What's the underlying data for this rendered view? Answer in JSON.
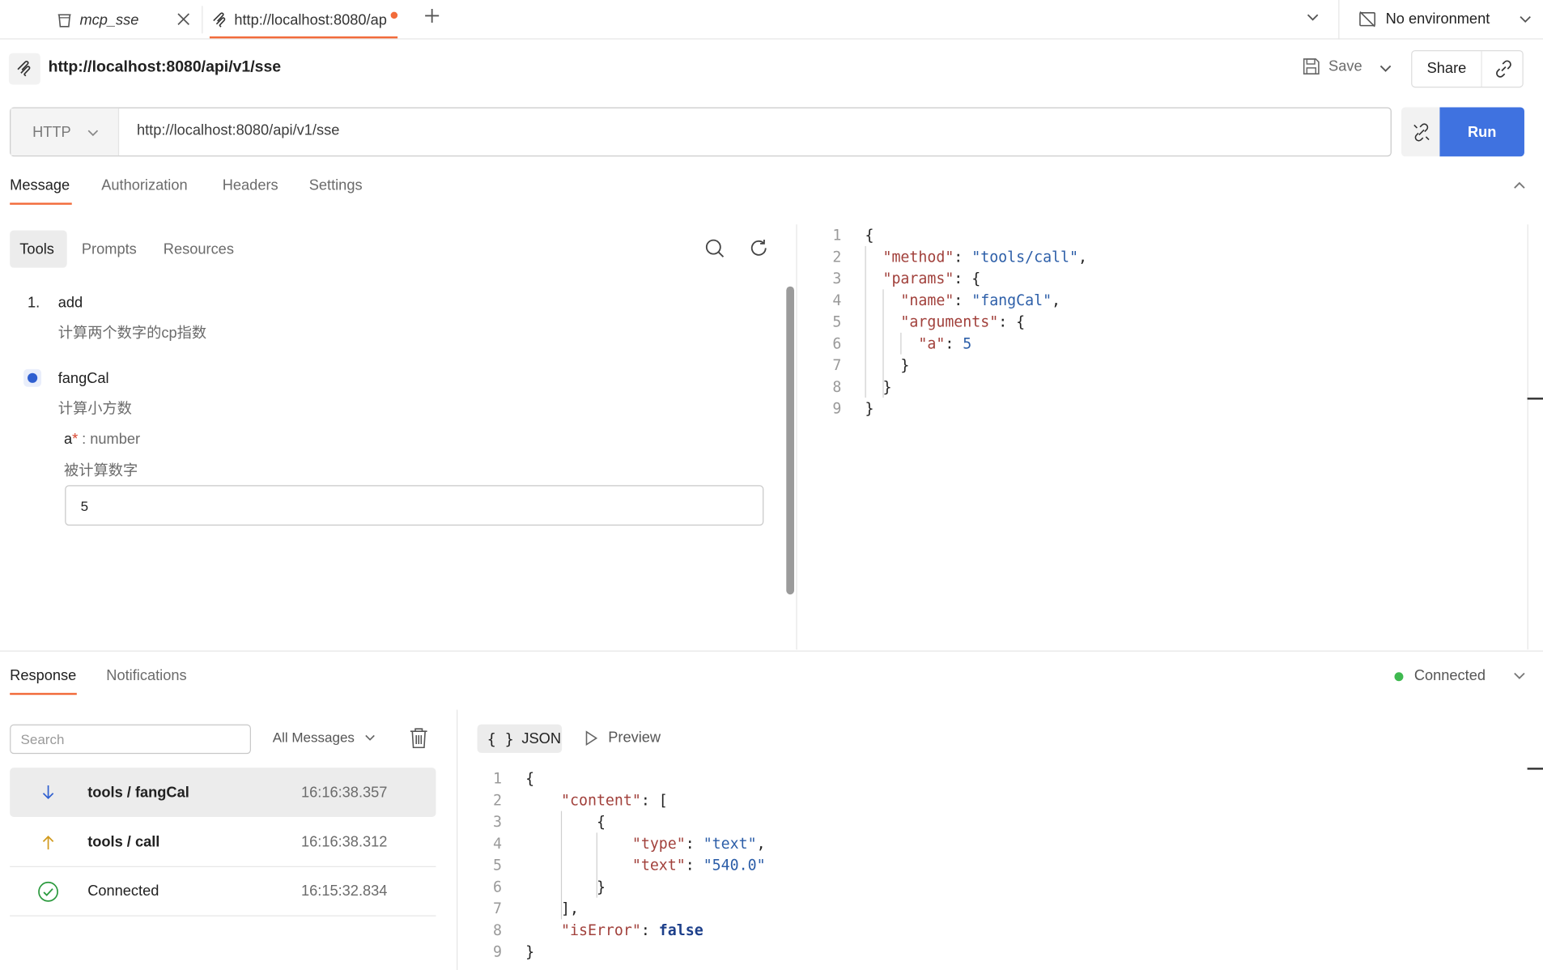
{
  "tabs": [
    {
      "label": "mcp_sse"
    },
    {
      "label": "http://localhost:8080/ap"
    }
  ],
  "environment": {
    "label": "No environment"
  },
  "request": {
    "title": "http://localhost:8080/api/v1/sse",
    "method": "HTTP",
    "url": "http://localhost:8080/api/v1/sse",
    "save_label": "Save",
    "share_label": "Share",
    "run_label": "Run"
  },
  "request_tabs": [
    "Message",
    "Authorization",
    "Headers",
    "Settings"
  ],
  "sub_tabs": [
    "Tools",
    "Prompts",
    "Resources"
  ],
  "tools": [
    {
      "index": "1.",
      "name": "add",
      "description": "计算两个数字的cp指数"
    },
    {
      "name": "fangCal",
      "description": "计算小方数"
    }
  ],
  "param": {
    "name": "a",
    "required_mark": "*",
    "type": ": number",
    "description": "被计算数字",
    "value": "5"
  },
  "request_body": {
    "line_numbers": [
      "1",
      "2",
      "3",
      "4",
      "5",
      "6",
      "7",
      "8",
      "9"
    ]
  },
  "response_tabs": [
    "Response",
    "Notifications"
  ],
  "connection": {
    "status": "Connected",
    "color": "#3fb950"
  },
  "messages": {
    "search_placeholder": "Search",
    "filter_label": "All Messages",
    "rows": [
      {
        "name": "tools / fangCal",
        "time": "16:16:38.357",
        "direction": "incoming-arrow-icon"
      },
      {
        "name": "tools / call",
        "time": "16:16:38.312",
        "direction": "outgoing-arrow-icon"
      },
      {
        "name": "Connected",
        "time": "16:15:32.834",
        "direction": "check-circle-icon"
      }
    ]
  },
  "response_view": {
    "json_label": "JSON",
    "json_icon": "{ }",
    "preview_label": "Preview",
    "line_numbers": [
      "1",
      "2",
      "3",
      "4",
      "5",
      "6",
      "7",
      "8",
      "9"
    ]
  },
  "colors": {
    "accent": "#f26b3a",
    "run_button": "#3f72e0",
    "selected_tool": "#2f5fd0"
  }
}
